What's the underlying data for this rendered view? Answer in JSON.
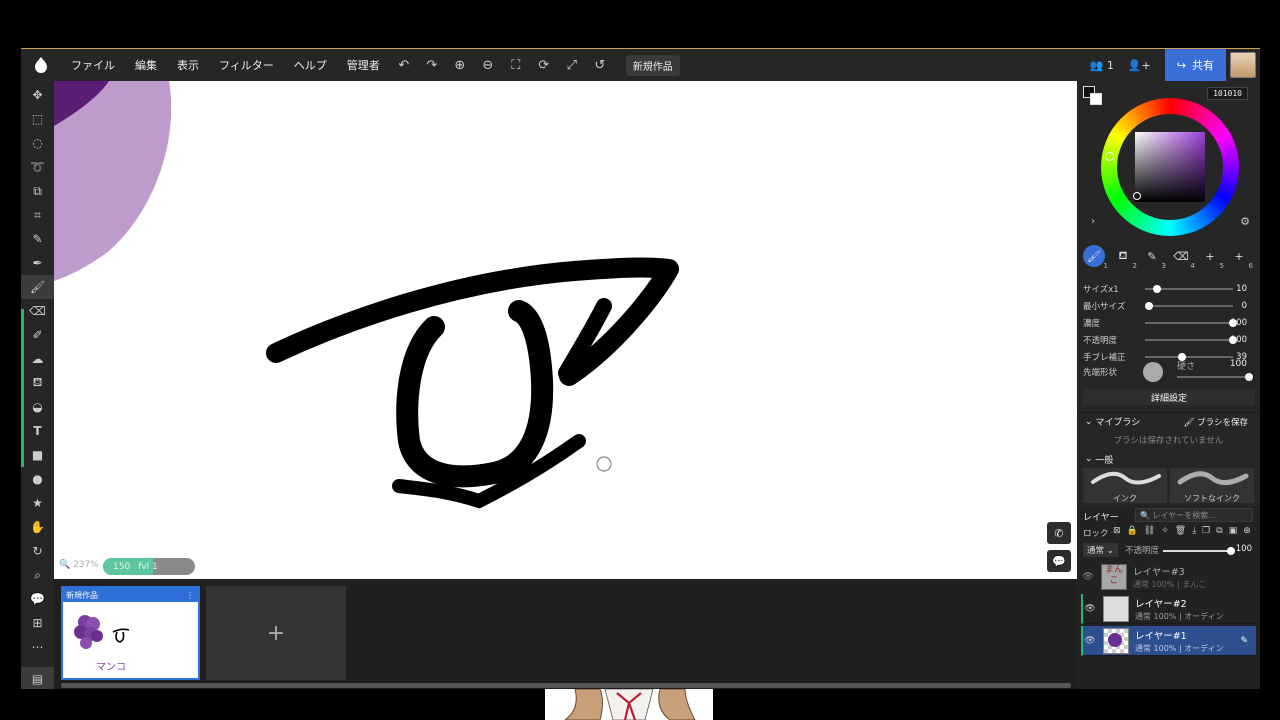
{
  "menubar": {
    "items": [
      "ファイル",
      "編集",
      "表示",
      "フィルター",
      "ヘルプ",
      "管理者"
    ],
    "document_tab": "新規作品",
    "user_count": "1",
    "share_label": "共有"
  },
  "canvas": {
    "zoom": "237%",
    "brush_info": [
      "150",
      "fvl 1"
    ]
  },
  "pages": {
    "thumb_title": "新規作品",
    "thumb_caption": "マンコ",
    "add_label": "+"
  },
  "color": {
    "hex": "101010",
    "current": "#101010"
  },
  "brush_settings": {
    "slots": [
      "1",
      "2",
      "3",
      "4",
      "5",
      "6"
    ],
    "rows": [
      {
        "label": "サイズx1",
        "value": "10",
        "fraction": 0.1
      },
      {
        "label": "最小サイズ",
        "value": "0",
        "fraction": 0.0
      },
      {
        "label": "濃度",
        "value": "100",
        "fraction": 1.0
      },
      {
        "label": "不透明度",
        "value": "100",
        "fraction": 1.0
      },
      {
        "label": "手ブレ補正",
        "value": "39",
        "fraction": 0.39
      }
    ],
    "tip_label": "先端形状",
    "hardness_label": "硬さ",
    "hardness_value": "100",
    "detail_button": "詳細設定"
  },
  "my_brush": {
    "title": "マイブラシ",
    "save_button": "ブラシを保存",
    "empty_text": "ブラシは保存されていません",
    "general_title": "一般",
    "presets": [
      "インク",
      "ソフトなインク"
    ]
  },
  "layers": {
    "title": "レイヤー",
    "search_placeholder": "レイヤーを検索...",
    "lock_label": "ロック",
    "blend_mode": "通常",
    "opacity_label": "不透明度",
    "opacity_value": "100",
    "items": [
      {
        "name": "レイヤー#3",
        "meta": "通常 100% | まんこ"
      },
      {
        "name": "レイヤー#2",
        "meta": "通常 100% | オーディン"
      },
      {
        "name": "レイヤー#1",
        "meta": "通常 100% | オーディン"
      }
    ]
  }
}
